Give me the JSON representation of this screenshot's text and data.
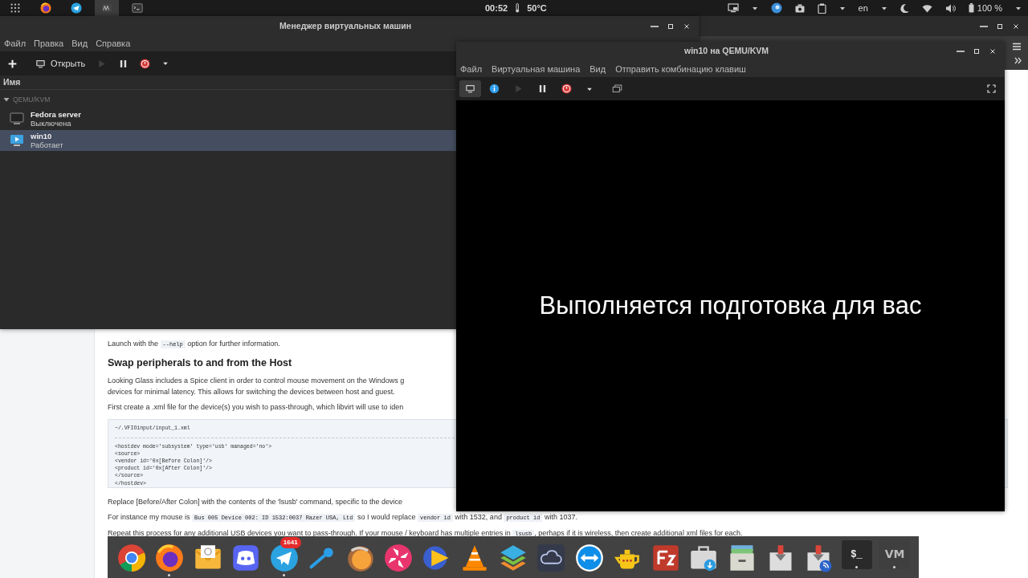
{
  "top_panel": {
    "launchers": [
      {
        "kind": "grid",
        "selected": false
      },
      {
        "kind": "firefox",
        "selected": false
      },
      {
        "kind": "telegram",
        "selected": false
      },
      {
        "kind": "virt-manager",
        "selected": true
      },
      {
        "kind": "terminal",
        "selected": false
      }
    ],
    "clock": "00:52",
    "temperature": "50°C",
    "keyboard_layout": "en",
    "battery": "100 %"
  },
  "browser": {
    "page": {
      "blocks": [
        {
          "kind": "paragraph",
          "lines": [
            [
              {
                "text": "Launch with the ",
                "code": false
              },
              {
                "text": "--help",
                "code": true
              },
              {
                "text": " option for further information.",
                "code": false
              }
            ]
          ]
        },
        {
          "kind": "heading",
          "text": "Swap peripherals to and from the Host"
        },
        {
          "kind": "paragraph",
          "lines": [
            [
              {
                "text": "Looking Glass includes a Spice client in order to control mouse movement on the Windows g",
                "code": false
              }
            ],
            [
              {
                "text": "devices for minimal latency. This allows for switching the devices between host and guest.",
                "code": false
              }
            ]
          ]
        },
        {
          "kind": "paragraph",
          "lines": [
            [
              {
                "text": "First create a .xml file for the device(s) you wish to pass-through, which libvirt will use to iden",
                "code": false
              }
            ]
          ]
        },
        {
          "kind": "code",
          "filename": "~/.VFIOinput/input_1.xml",
          "lines": [
            "<hostdev mode='subsystem' type='usb' managed='no'>",
            "<source>",
            "<vendor id='0x[Before Colon]'/>",
            "<product id='0x[After Colon]'/>",
            "</source>",
            "</hostdev>"
          ]
        },
        {
          "kind": "paragraph",
          "lines": [
            [
              {
                "text": "Replace [Before/After Colon] with the contents of the 'lsusb' command, specific to the device",
                "code": false
              }
            ]
          ]
        },
        {
          "kind": "paragraph",
          "lines": [
            [
              {
                "text": "For instance my mouse is ",
                "code": false
              },
              {
                "text": "Bus 005 Device 002: ID 1532:0037 Razer USA, Ltd",
                "code": true
              },
              {
                "text": " so I would replace ",
                "code": false
              },
              {
                "text": "vendor id",
                "code": true
              },
              {
                "text": " with 1532, and ",
                "code": false
              },
              {
                "text": "product id",
                "code": true
              },
              {
                "text": " with 1037.",
                "code": false
              }
            ]
          ]
        },
        {
          "kind": "paragraph",
          "lines": [
            [
              {
                "text": "Repeat this process for any additional USB devices you want to pass-through. If your mouse / keyboard has multiple entries in ",
                "code": false
              },
              {
                "text": "lsusb",
                "code": true
              },
              {
                "text": ", perhaps if it is wireless, then create additional xml files for each.",
                "code": false
              }
            ]
          ]
        }
      ]
    }
  },
  "manager_window": {
    "title": "Менеджер виртуальных машин",
    "menu": [
      "Файл",
      "Правка",
      "Вид",
      "Справка"
    ],
    "toolbar": [
      {
        "kind": "add",
        "disabled": false
      },
      {
        "kind": "open",
        "label": "Открыть",
        "disabled": false
      },
      {
        "kind": "run",
        "disabled": true
      },
      {
        "kind": "pause",
        "disabled": false
      },
      {
        "kind": "shutdown",
        "disabled": false
      },
      {
        "kind": "dropdown",
        "disabled": false
      }
    ],
    "column": "Имя",
    "group": {
      "name": "QEMU/KVM",
      "expanded": true,
      "children": [
        {
          "name": "Fedora server",
          "status": "Выключена",
          "running": false,
          "selected": false
        },
        {
          "name": "win10",
          "status": "Работает",
          "running": true,
          "selected": true
        }
      ]
    }
  },
  "viewer_window": {
    "title": "win10 на QEMU/KVM",
    "menu": [
      "Файл",
      "Виртуальная машина",
      "Вид",
      "Отправить комбинацию клавиш"
    ],
    "toolbar": [
      {
        "kind": "console",
        "selected": true,
        "disabled": false
      },
      {
        "kind": "details",
        "selected": false,
        "disabled": false
      },
      {
        "kind": "run",
        "selected": false,
        "disabled": true
      },
      {
        "kind": "pause",
        "selected": false,
        "disabled": false
      },
      {
        "kind": "shutdown",
        "selected": false,
        "disabled": false
      },
      {
        "kind": "dropdown",
        "selected": false,
        "disabled": false
      },
      {
        "kind": "screens",
        "selected": false,
        "disabled": false
      }
    ],
    "screen_text": "Выполняется подготовка для вас"
  },
  "dock": {
    "items": [
      {
        "kind": "chrome",
        "running": false
      },
      {
        "kind": "firefox",
        "running": true
      },
      {
        "kind": "mail",
        "running": false
      },
      {
        "kind": "discord",
        "running": false
      },
      {
        "kind": "telegram",
        "running": true,
        "badge": "1641"
      },
      {
        "kind": "stick",
        "running": false
      },
      {
        "kind": "creature",
        "running": false
      },
      {
        "kind": "pinwheel",
        "running": false
      },
      {
        "kind": "video",
        "running": false
      },
      {
        "kind": "cone",
        "running": false
      },
      {
        "kind": "layers",
        "running": false
      },
      {
        "kind": "cloud",
        "running": false
      },
      {
        "kind": "arrows",
        "running": false
      },
      {
        "kind": "teapot",
        "running": false
      },
      {
        "kind": "ftp",
        "running": false
      },
      {
        "kind": "bag",
        "running": false
      },
      {
        "kind": "drawer",
        "running": false
      },
      {
        "kind": "download",
        "running": false
      },
      {
        "kind": "feed",
        "running": false
      },
      {
        "kind": "terminal",
        "running": true,
        "label": "$_"
      },
      {
        "kind": "virt-manager",
        "running": true,
        "label": "VM"
      }
    ]
  }
}
